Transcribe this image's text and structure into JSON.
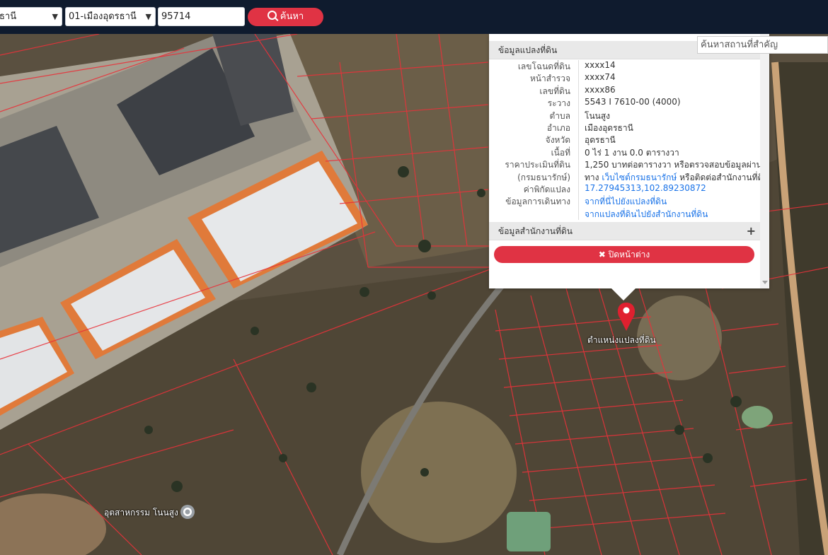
{
  "toolbar": {
    "province_value": "ธานี",
    "district_value": "01-เมืองอุดรธานี",
    "parcel_value": "95714",
    "search_label": "ค้นหา",
    "chevron": "chevron-down-icon",
    "search_icon": "search-icon"
  },
  "place_search": {
    "placeholder": "ค้นหาสถานที่สำคัญ"
  },
  "popup": {
    "section_title": "ข้อมูลแปลงที่ดิน",
    "fields": [
      {
        "label": "เลขโฉนดที่ดิน",
        "value": "xxxx14"
      },
      {
        "label": "หน้าสำรวจ",
        "value": "xxxx74"
      },
      {
        "label": "เลขที่ดิน",
        "value": "xxxx86"
      },
      {
        "label": "ระวาง",
        "value": "5543 I 7610-00 (4000)"
      },
      {
        "label": "ตำบล",
        "value": "โนนสูง"
      },
      {
        "label": "อำเภอ",
        "value": "เมืองอุดรธานี"
      },
      {
        "label": "จังหวัด",
        "value": "อุดรธานี"
      },
      {
        "label": "เนื้อที่",
        "value": "0 ไร่ 1 งาน 0.0 ตารางวา"
      },
      {
        "label": "ราคาประเมินที่ดิน",
        "value": "1,250 บาทต่อตารางวา หรือตรวจสอบข้อมูลผ่าน"
      },
      {
        "label": "(กรมธนารักษ์)",
        "value_prefix": "ทาง",
        "value_link": "เว็บไซต์กรมธนารักษ์",
        "value_suffix": "หรือติดต่อสำนักงานที่ดิน"
      },
      {
        "label": "ค่าพิกัดแปลง",
        "value_link": "17.27945313,102.89230872"
      },
      {
        "label": "ข้อมูลการเดินทาง",
        "value_link": "จากที่นี่ไปยังแปลงที่ดิน"
      },
      {
        "label": "",
        "value_link": "จากแปลงที่ดินไปยังสำนักงานที่ดิน"
      }
    ],
    "office_section_title": "ข้อมูลสำนักงานที่ดิน",
    "close_label": "ปิดหน้าต่าง"
  },
  "map": {
    "pin_label": "ตำแหน่งแปลงที่ดิน",
    "poi_label": "อุตสาหกรรม โนนสูง",
    "pin_icon": "map-pin-icon",
    "poi_icon": "location-dot-icon",
    "parcel_line_color": "#e8323a",
    "pin_color": "#e0202f"
  }
}
